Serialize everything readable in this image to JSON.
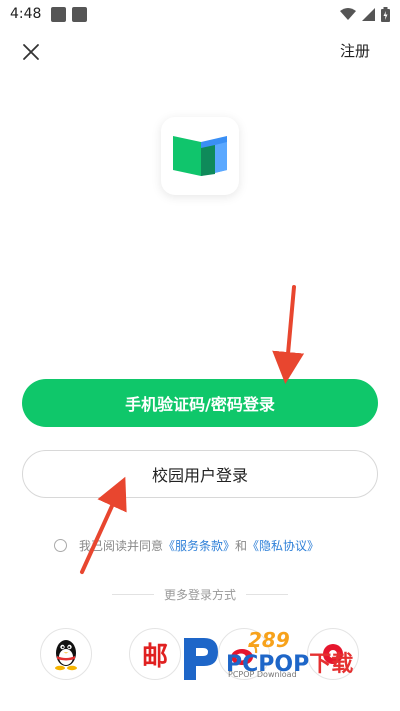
{
  "status_bar": {
    "time": "4:48"
  },
  "header": {
    "register_label": "注册"
  },
  "buttons": {
    "primary_label": "手机验证码/密码登录",
    "secondary_label": "校园用户登录"
  },
  "agreement": {
    "prefix": "我已阅读并同意",
    "terms_link": "《服务条款》",
    "conjunction": "和",
    "privacy_link": "《隐私协议》"
  },
  "more_login": {
    "label": "更多登录方式"
  },
  "social": {
    "mail_glyph": "邮"
  },
  "watermark": {
    "brand_main": "PCPOP",
    "brand_tail": "下载",
    "brand_sub": "PCPOP Download",
    "number": "289"
  },
  "colors": {
    "primary": "#0fc76a",
    "link": "#2f80d8",
    "annotation_arrow": "#e8462f"
  }
}
